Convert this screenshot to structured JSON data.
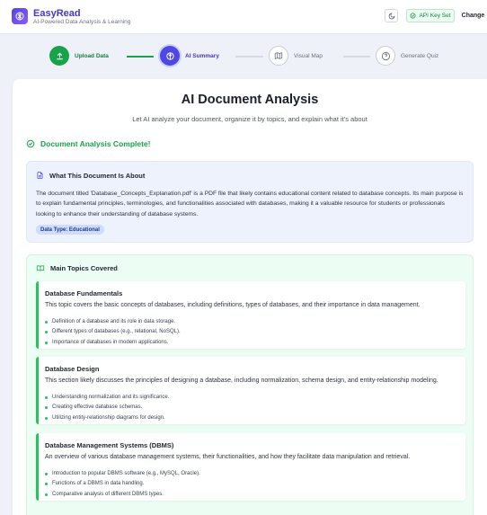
{
  "header": {
    "app_name": "EasyRead",
    "tagline": "AI-Powered Data Analysis & Learning",
    "api_key_label": "API Key Set",
    "change_label": "Change"
  },
  "steps": [
    {
      "label": "Upload Data",
      "state": "done"
    },
    {
      "label": "AI Summary",
      "state": "active"
    },
    {
      "label": "Visual Map",
      "state": "todo"
    },
    {
      "label": "Generate Quiz",
      "state": "todo"
    }
  ],
  "main": {
    "title": "AI Document Analysis",
    "subtitle": "Let AI analyze your document, organize it by topics, and explain what it's about",
    "complete_label": "Document Analysis Complete!",
    "about": {
      "heading": "What This Document Is About",
      "text": "The document titled 'Database_Concepts_Explanation.pdf' is a PDF file that likely contains educational content related to database concepts. Its main purpose is to explain fundamental principles, terminologies, and functionalities associated with databases, making it a valuable resource for students or professionals looking to enhance their understanding of database systems.",
      "badge": "Data Type: Educational"
    },
    "topics_heading": "Main Topics Covered",
    "topics": [
      {
        "title": "Database Fundamentals",
        "description": "This topic covers the basic concepts of databases, including definitions, types of databases, and their importance in data management.",
        "points": [
          "Definition of a database and its role in data storage.",
          "Different types of databases (e.g., relational, NoSQL).",
          "Importance of databases in modern applications."
        ]
      },
      {
        "title": "Database Design",
        "description": "This section likely discusses the principles of designing a database, including normalization, schema design, and entity-relationship modeling.",
        "points": [
          "Understanding normalization and its significance.",
          "Creating effective database schemas.",
          "Utilizing entity-relationship diagrams for design."
        ]
      },
      {
        "title": "Database Management Systems (DBMS)",
        "description": "An overview of various database management systems, their functionalities, and how they facilitate data manipulation and retrieval.",
        "points": [
          "Introduction to popular DBMS software (e.g., MySQL, Oracle).",
          "Functions of a DBMS in data handling.",
          "Comparative analysis of different DBMS types."
        ]
      }
    ]
  },
  "icons": {
    "logo": "brain-icon",
    "theme": "moon-icon",
    "api_key": "check-circle-icon",
    "upload": "upload-icon",
    "summary": "brain-icon",
    "visual_map": "map-icon",
    "quiz": "help-circle-icon",
    "about": "document-icon",
    "topics": "book-open-icon"
  },
  "colors": {
    "primary": "#4f46e5",
    "success": "#16a34a",
    "about_bg": "#eef2fc",
    "topics_bg": "#ecfdf3"
  }
}
